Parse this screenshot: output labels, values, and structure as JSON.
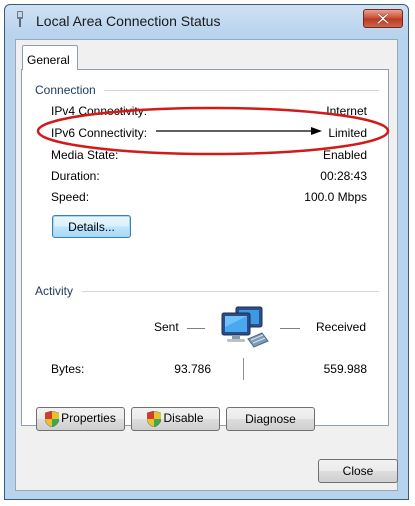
{
  "window": {
    "title": "Local Area Connection Status"
  },
  "tabs": [
    {
      "label": "General"
    }
  ],
  "connection": {
    "heading": "Connection",
    "rows": [
      {
        "label": "IPv4 Connectivity:",
        "value": "Internet"
      },
      {
        "label": "IPv6 Connectivity:",
        "value": "Limited"
      },
      {
        "label": "Media State:",
        "value": "Enabled"
      },
      {
        "label": "Duration:",
        "value": "00:28:43"
      },
      {
        "label": "Speed:",
        "value": "100.0 Mbps"
      }
    ],
    "details_button": "Details..."
  },
  "activity": {
    "heading": "Activity",
    "sent_label": "Sent",
    "received_label": "Received",
    "bytes_label": "Bytes:",
    "bytes_sent": "93.786",
    "bytes_received": "559.988"
  },
  "buttons": {
    "properties": "Properties",
    "disable": "Disable",
    "diagnose": "Diagnose",
    "close": "Close"
  },
  "icons": {
    "title": "network-connection-icon",
    "close": "close-icon",
    "network": "network-computers-icon",
    "shield": "uac-shield-icon"
  },
  "colors": {
    "annotation_red": "#d11a1a",
    "title_bar": "#b8d3ee",
    "close_button": "#c94a2f"
  }
}
